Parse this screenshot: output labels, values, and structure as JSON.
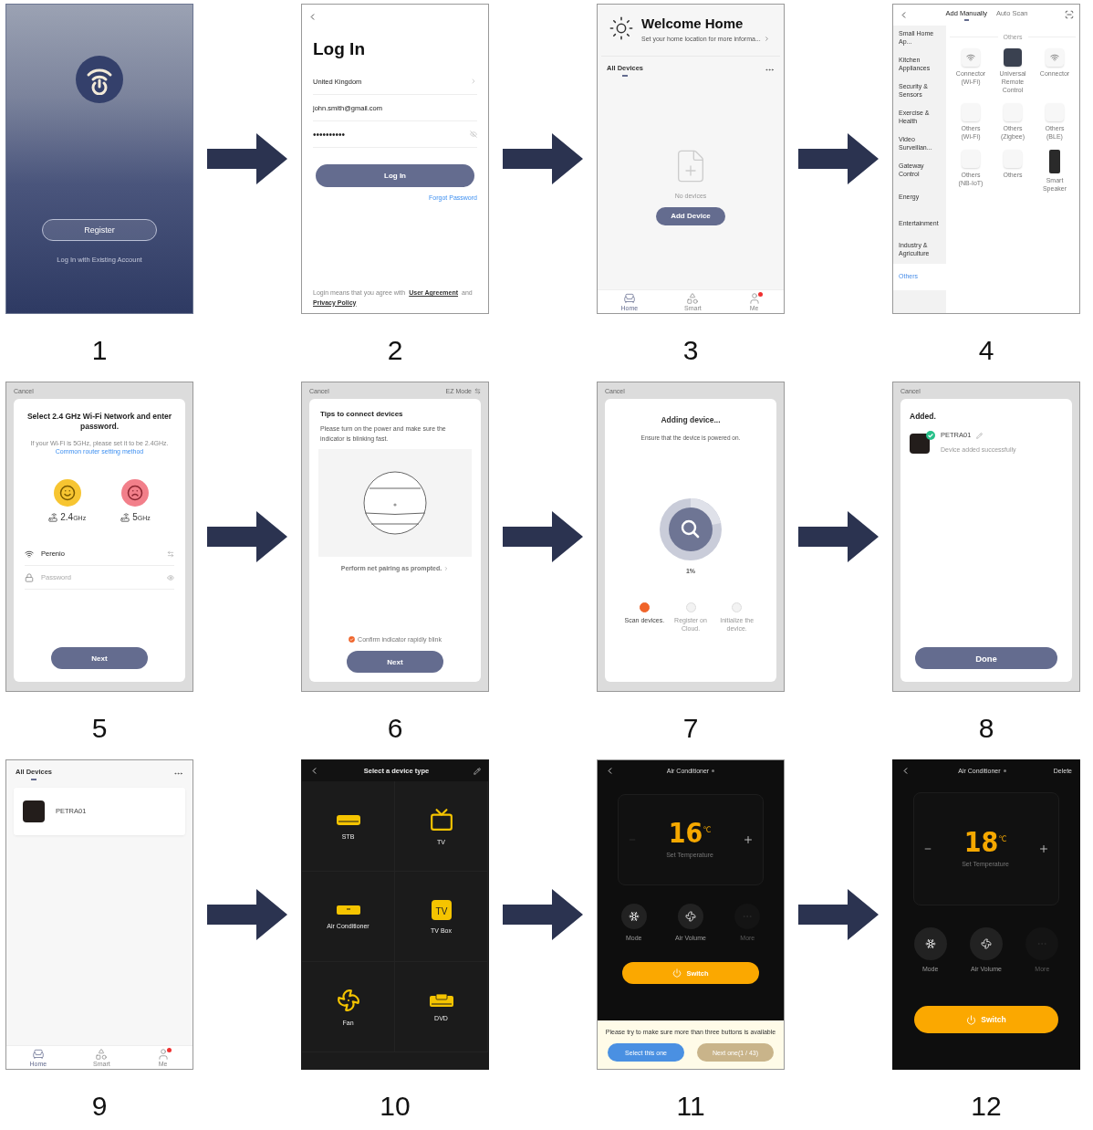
{
  "screens": [
    {
      "kind": "splash",
      "step": "1",
      "register_button": "Register",
      "login_link": "Log In with Existing Account"
    },
    {
      "kind": "login",
      "step": "2",
      "title": "Log In",
      "fields": [
        {
          "kind": "select",
          "value": "United Kingdom"
        },
        {
          "kind": "text",
          "value": "john.smith@gmail.com"
        },
        {
          "kind": "password",
          "value": "••••••••••"
        }
      ],
      "button": "Log In",
      "forgot_link": "Forgot Password",
      "legal_text": "Login means that you agree with",
      "agreement_link": "User Agreement",
      "and_text": "and",
      "privacy_link": "Privacy Policy"
    },
    {
      "kind": "home",
      "step": "3",
      "title": "Welcome Home",
      "subtitle": "Set your home location for more informa...",
      "section": "All Devices",
      "empty_text": "No devices",
      "button": "Add Device",
      "nav": [
        {
          "label": "Home",
          "selected": true,
          "badge": false
        },
        {
          "label": "Smart",
          "selected": false,
          "badge": false
        },
        {
          "label": "Me",
          "selected": false,
          "badge": true
        }
      ]
    },
    {
      "kind": "add",
      "step": "4",
      "tabs": [
        {
          "label": "Add Manually",
          "selected": true
        },
        {
          "label": "Auto Scan",
          "selected": false
        }
      ],
      "categories": [
        {
          "label": "Small Home Ap...",
          "selected": false
        },
        {
          "label": "Kitchen Appliances",
          "selected": false
        },
        {
          "label": "Security & Sensors",
          "selected": false
        },
        {
          "label": "Exercise & Health",
          "selected": false
        },
        {
          "label": "Video Surveillan...",
          "selected": false
        },
        {
          "label": "Gateway Control",
          "selected": false
        },
        {
          "label": "Energy",
          "selected": false
        },
        {
          "label": "Entertainment",
          "selected": false
        },
        {
          "label": "Industry & Agriculture",
          "selected": false
        },
        {
          "label": "Others",
          "selected": true
        }
      ],
      "group_title": "Others",
      "devices": [
        {
          "kind": "wifi",
          "name": "Connector",
          "note": "(Wi-Fi)"
        },
        {
          "kind": "remote",
          "name": "Universal Remote Control"
        },
        {
          "kind": "wifi",
          "name": "Connector"
        },
        {
          "kind": "plain",
          "name": "Others",
          "note": "(Wi-Fi)"
        },
        {
          "kind": "plain",
          "name": "Others",
          "note": "(Zigbee)"
        },
        {
          "kind": "plain",
          "name": "Others",
          "note": "(BLE)"
        },
        {
          "kind": "plain",
          "name": "Others",
          "note": "(NB-IoT)"
        },
        {
          "kind": "plain",
          "name": "Others"
        },
        {
          "kind": "speaker",
          "name": "Smart Speaker"
        }
      ]
    },
    {
      "kind": "wifi",
      "step": "5",
      "cancel": "Cancel",
      "title": "Select 2.4 GHz Wi-Fi Network and enter password.",
      "note": "If your Wi-Fi is 5GHz, please set it to be 2.4GHz.",
      "note_link": "Common router setting method",
      "bands": [
        {
          "value": "2.4",
          "unit": "GHz",
          "supported": true
        },
        {
          "value": "5",
          "unit": "GHz",
          "supported": false
        }
      ],
      "network": "Perenio",
      "password_placeholder": "Password",
      "button": "Next"
    },
    {
      "kind": "tips",
      "step": "6",
      "cancel": "Cancel",
      "mode": "EZ Mode",
      "title": "Tips to connect devices",
      "text": "Please turn on the power and make sure the indicator is blinking fast.",
      "prompt": "Perform net pairing as prompted.",
      "confirm": {
        "label": "Confirm indicator rapidly blink",
        "checked": true
      },
      "button": "Next"
    },
    {
      "kind": "adding",
      "step": "7",
      "cancel": "Cancel",
      "title": "Adding device...",
      "text": "Ensure that the device is powered on.",
      "progress": "1%",
      "steps": [
        {
          "label": "Scan devices.",
          "active": true
        },
        {
          "label": "Register on Cloud.",
          "active": false
        },
        {
          "label": "Initialize the device.",
          "active": false
        }
      ]
    },
    {
      "kind": "added",
      "step": "8",
      "cancel": "Cancel",
      "title": "Added.",
      "device": "PETRA01",
      "status": "Device added successfully",
      "button": "Done"
    },
    {
      "kind": "devices",
      "step": "9",
      "section": "All Devices",
      "devices": [
        {
          "name": "PETRA01"
        }
      ],
      "nav": [
        {
          "label": "Home",
          "selected": true,
          "badge": false
        },
        {
          "label": "Smart",
          "selected": false,
          "badge": false
        },
        {
          "label": "Me",
          "selected": false,
          "badge": true
        }
      ]
    },
    {
      "kind": "types",
      "step": "10",
      "title": "Select a device type",
      "types": [
        {
          "kind": "stb",
          "label": "STB"
        },
        {
          "kind": "tv",
          "label": "TV"
        },
        {
          "kind": "ac",
          "label": "Air Conditioner"
        },
        {
          "kind": "tvbox",
          "label": "TV Box",
          "icon_text": "TV"
        },
        {
          "kind": "fan",
          "label": "Fan"
        },
        {
          "kind": "dvd",
          "label": "DVD"
        }
      ]
    },
    {
      "kind": "remote",
      "step": "11",
      "title": "Air Conditioner",
      "temperature": "16",
      "unit": "℃",
      "temp_label": "Set Temperature",
      "minus_disabled": true,
      "controls": [
        {
          "kind": "mode",
          "label": "Mode",
          "disabled": false
        },
        {
          "kind": "volume",
          "label": "Air Volume",
          "disabled": false
        },
        {
          "kind": "more",
          "label": "More",
          "disabled": true
        }
      ],
      "switch": "Switch",
      "notice": {
        "text": "Please try to make sure more than three buttons is available",
        "select": "Select this one",
        "next": "Next one(1 / 43)"
      }
    },
    {
      "kind": "remote",
      "step": "12",
      "title": "Air Conditioner",
      "action": "Delete",
      "temperature": "18",
      "unit": "℃",
      "temp_label": "Set Temperature",
      "minus_disabled": false,
      "controls": [
        {
          "kind": "mode",
          "label": "Mode",
          "disabled": false
        },
        {
          "kind": "volume",
          "label": "Air Volume",
          "disabled": false
        },
        {
          "kind": "more",
          "label": "More",
          "disabled": true
        }
      ],
      "switch": "Switch"
    }
  ]
}
